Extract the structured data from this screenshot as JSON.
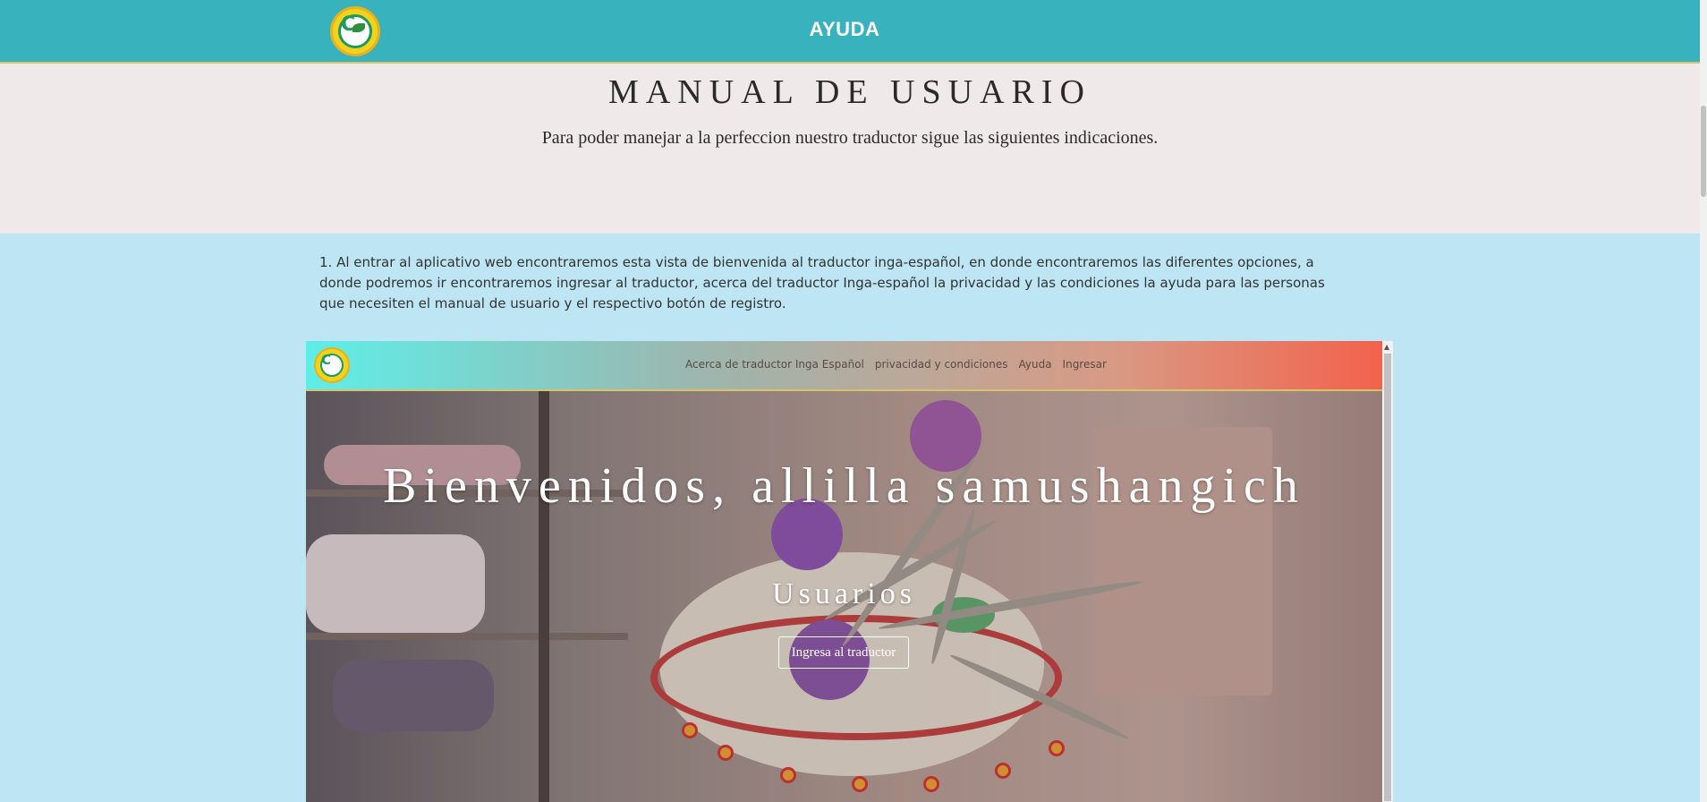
{
  "header": {
    "title": "AYUDA",
    "logo_icon": "community-logo-icon"
  },
  "intro": {
    "title": "MANUAL DE USUARIO",
    "subtitle": "Para poder manejar a la perfeccion nuestro traductor sigue las siguientes indicaciones."
  },
  "steps": [
    {
      "text": "1. Al entrar al aplicativo web encontraremos esta vista de bienvenida al traductor inga-español, en donde encontraremos las diferentes opciones, a donde podremos ir encontraremos ingresar al traductor, acerca del traductor Inga-español la privacidad y las condiciones la ayuda para las personas que necesiten el manual de usuario y el respectivo botón de registro."
    }
  ],
  "screenshot": {
    "nav": [
      "Acerca de traductor Inga Español",
      "privacidad y condiciones",
      "Ayuda",
      "Ingresar"
    ],
    "hero_title": "Bienvenidos, allilla samushangich",
    "hero_subtitle": "Usuarios",
    "hero_button": "Ingresa al traductor"
  },
  "colors": {
    "header_bg": "#38b2bd",
    "intro_bg": "#efeae9",
    "content_bg": "#bde5f3",
    "accent_gradient_start": "#5eeee8",
    "accent_gradient_end": "#f3624c"
  }
}
